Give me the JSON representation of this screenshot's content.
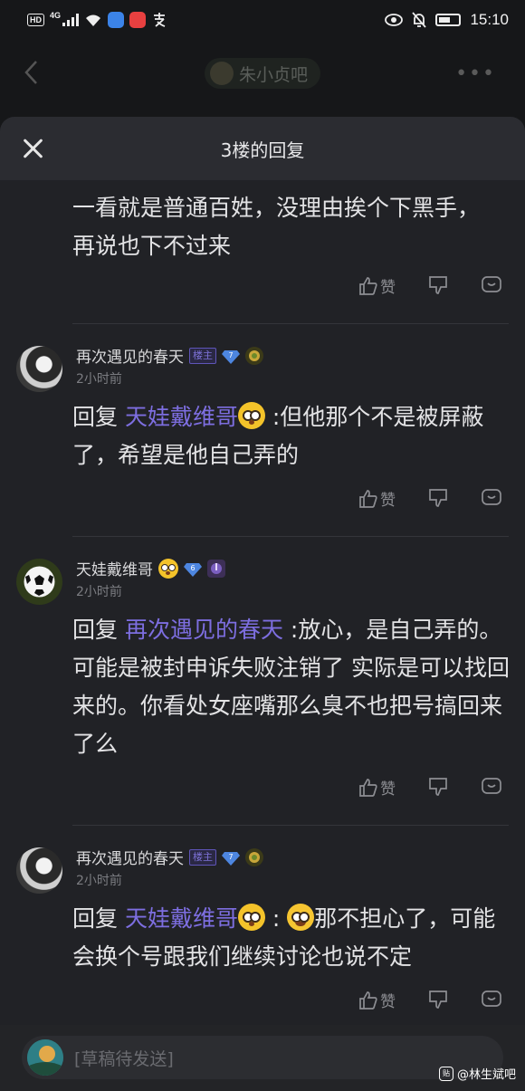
{
  "status_bar": {
    "left_tag": "HD",
    "net": "4G",
    "time": "15:10"
  },
  "forum": {
    "name": "朱小贞吧"
  },
  "sheet": {
    "title": "3楼的回复"
  },
  "action_labels": {
    "like": "赞"
  },
  "first_text": "一看就是普通百姓，没理由挨个下黑手，再说也下不过来",
  "replies": [
    {
      "user": "再次遇见的春天",
      "badge": "楼主",
      "level": "7",
      "time": "2小时前",
      "prefix": "回复 ",
      "target": "天娃戴维哥",
      "body": " :但他那个不是被屏蔽了，希望是他自己弄的"
    },
    {
      "user": "天娃戴维哥",
      "level": "6",
      "time": "2小时前",
      "prefix": "回复 ",
      "target": "再次遇见的春天",
      "body": " :放心，是自己弄的。可能是被封申诉失败注销了 实际是可以找回来的。你看处女座嘴那么臭不也把号搞回来了么"
    },
    {
      "user": "再次遇见的春天",
      "badge": "楼主",
      "level": "7",
      "time": "2小时前",
      "prefix": "回复 ",
      "target": "天娃戴维哥",
      "body_a": " : ",
      "body_b": "那不担心了，可能会换个号跟我们继续讨论也说不定"
    }
  ],
  "draft": {
    "placeholder": "[草稿待发送]"
  },
  "watermark": {
    "text": "@林生斌吧",
    "logo": "贴"
  },
  "colors": {
    "accent_reply": "#7d6ee0",
    "sheet_bg": "#212226",
    "header_bg": "#2b2c31"
  }
}
